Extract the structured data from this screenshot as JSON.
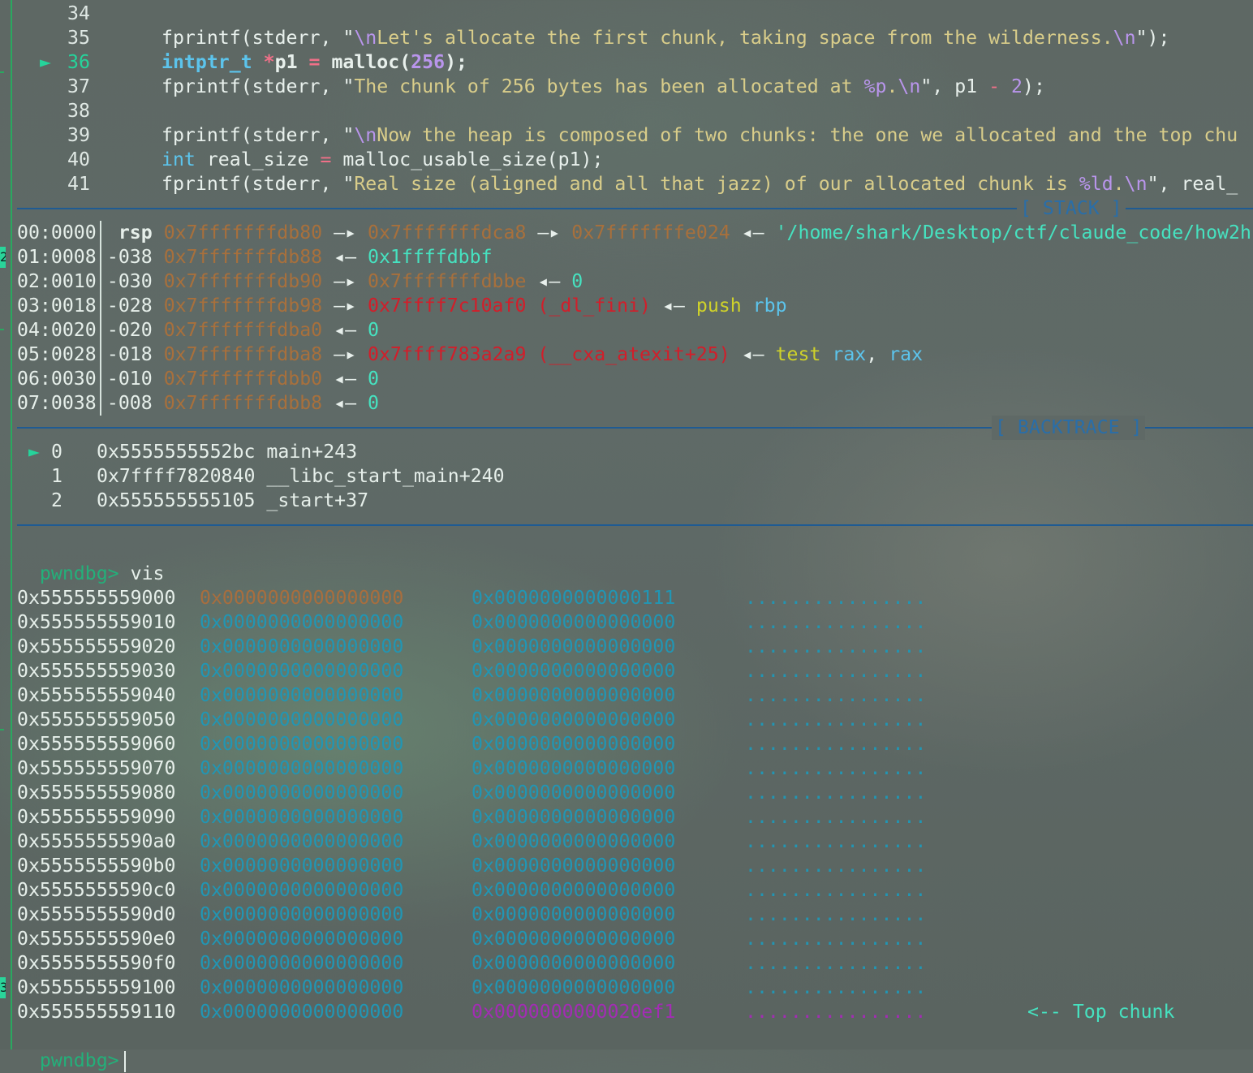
{
  "source": {
    "lines": [
      {
        "num": "34",
        "current": false,
        "tokens": []
      },
      {
        "num": "35",
        "current": false,
        "tokens": [
          {
            "t": "fprintf(stderr, \"",
            "c": "c-white"
          },
          {
            "t": "\\n",
            "c": "c-esc"
          },
          {
            "t": "Let's allocate the first chunk, taking space from the wilderness.",
            "c": "c-str"
          },
          {
            "t": "\\n",
            "c": "c-esc"
          },
          {
            "t": "\");",
            "c": "c-white"
          }
        ]
      },
      {
        "num": "36",
        "current": true,
        "arrow": "►",
        "tokens": [
          {
            "t": "intptr_t",
            "c": "c-type c-bold"
          },
          {
            "t": " ",
            "c": "c-white"
          },
          {
            "t": "*",
            "c": "c-op c-bold"
          },
          {
            "t": "p1",
            "c": "c-white c-bold"
          },
          {
            "t": " ",
            "c": "c-white"
          },
          {
            "t": "=",
            "c": "c-op c-bold"
          },
          {
            "t": " malloc(",
            "c": "c-white c-bold"
          },
          {
            "t": "256",
            "c": "c-num c-bold"
          },
          {
            "t": ");",
            "c": "c-white c-bold"
          }
        ]
      },
      {
        "num": "37",
        "current": false,
        "tokens": [
          {
            "t": "fprintf(stderr, \"",
            "c": "c-white"
          },
          {
            "t": "The chunk of 256 bytes has been allocated at ",
            "c": "c-str"
          },
          {
            "t": "%p",
            "c": "c-esc"
          },
          {
            "t": ".",
            "c": "c-str"
          },
          {
            "t": "\\n",
            "c": "c-esc"
          },
          {
            "t": "\", p1 ",
            "c": "c-white"
          },
          {
            "t": "-",
            "c": "c-op"
          },
          {
            "t": " ",
            "c": "c-white"
          },
          {
            "t": "2",
            "c": "c-num"
          },
          {
            "t": ");",
            "c": "c-white"
          }
        ]
      },
      {
        "num": "38",
        "current": false,
        "tokens": []
      },
      {
        "num": "39",
        "current": false,
        "tokens": [
          {
            "t": "fprintf(stderr, \"",
            "c": "c-white"
          },
          {
            "t": "\\n",
            "c": "c-esc"
          },
          {
            "t": "Now the heap is composed of two chunks: the one we allocated and the top chu",
            "c": "c-str"
          }
        ]
      },
      {
        "num": "40",
        "current": false,
        "tokens": [
          {
            "t": "int",
            "c": "c-type"
          },
          {
            "t": " real_size ",
            "c": "c-white"
          },
          {
            "t": "=",
            "c": "c-op"
          },
          {
            "t": " malloc_usable_size(p1);",
            "c": "c-white"
          }
        ]
      },
      {
        "num": "41",
        "current": false,
        "tokens": [
          {
            "t": "fprintf(stderr, \"",
            "c": "c-white"
          },
          {
            "t": "Real size (aligned and all that jazz) of our allocated chunk is ",
            "c": "c-str"
          },
          {
            "t": "%ld",
            "c": "c-esc"
          },
          {
            "t": ".",
            "c": "c-str"
          },
          {
            "t": "\\n",
            "c": "c-esc"
          },
          {
            "t": "\", real_",
            "c": "c-white"
          }
        ]
      }
    ]
  },
  "stack": {
    "title": "[ STACK ]",
    "rows": [
      {
        "idx": "00:0000",
        "off": "rsp",
        "tokens": [
          {
            "t": "0x7fffffffdb80",
            "c": "c-stk"
          },
          {
            "t": " —▸ ",
            "c": "c-arr"
          },
          {
            "t": "0x7fffffffdca8",
            "c": "c-stk"
          },
          {
            "t": " —▸ ",
            "c": "c-arr"
          },
          {
            "t": "0x7fffffffe024",
            "c": "c-stk"
          },
          {
            "t": " ◂— ",
            "c": "c-arr"
          },
          {
            "t": "'/home/shark/Desktop/ctf/claude_code/how2h",
            "c": "c-teal"
          }
        ]
      },
      {
        "idx": "01:0008",
        "off": "-038",
        "tokens": [
          {
            "t": "0x7fffffffdb88",
            "c": "c-stk"
          },
          {
            "t": " ◂— ",
            "c": "c-arr"
          },
          {
            "t": "0x1ffffdbbf",
            "c": "c-teal"
          }
        ]
      },
      {
        "idx": "02:0010",
        "off": "-030",
        "tokens": [
          {
            "t": "0x7fffffffdb90",
            "c": "c-stk"
          },
          {
            "t": " —▸ ",
            "c": "c-arr"
          },
          {
            "t": "0x7fffffffdbbe",
            "c": "c-stk"
          },
          {
            "t": " ◂— ",
            "c": "c-arr"
          },
          {
            "t": "0",
            "c": "c-teal"
          }
        ]
      },
      {
        "idx": "03:0018",
        "off": "-028",
        "tokens": [
          {
            "t": "0x7fffffffdb98",
            "c": "c-stk"
          },
          {
            "t": " —▸ ",
            "c": "c-arr"
          },
          {
            "t": "0x7ffff7c10af0 (_dl_fini)",
            "c": "c-red"
          },
          {
            "t": " ◂— ",
            "c": "c-arr"
          },
          {
            "t": "push",
            "c": "c-ins"
          },
          {
            "t": " ",
            "c": "c-arr"
          },
          {
            "t": "rbp",
            "c": "c-reg"
          }
        ]
      },
      {
        "idx": "04:0020",
        "off": "-020",
        "tokens": [
          {
            "t": "0x7fffffffdba0",
            "c": "c-stk"
          },
          {
            "t": " ◂— ",
            "c": "c-arr"
          },
          {
            "t": "0",
            "c": "c-teal"
          }
        ]
      },
      {
        "idx": "05:0028",
        "off": "-018",
        "tokens": [
          {
            "t": "0x7fffffffdba8",
            "c": "c-stk"
          },
          {
            "t": " —▸ ",
            "c": "c-arr"
          },
          {
            "t": "0x7ffff783a2a9 (__cxa_atexit+25)",
            "c": "c-red"
          },
          {
            "t": " ◂— ",
            "c": "c-arr"
          },
          {
            "t": "test",
            "c": "c-ins"
          },
          {
            "t": " ",
            "c": "c-arr"
          },
          {
            "t": "rax",
            "c": "c-reg"
          },
          {
            "t": ", ",
            "c": "c-arr"
          },
          {
            "t": "rax",
            "c": "c-reg"
          }
        ]
      },
      {
        "idx": "06:0030",
        "off": "-010",
        "tokens": [
          {
            "t": "0x7fffffffdbb0",
            "c": "c-stk"
          },
          {
            "t": " ◂— ",
            "c": "c-arr"
          },
          {
            "t": "0",
            "c": "c-teal"
          }
        ]
      },
      {
        "idx": "07:0038",
        "off": "-008",
        "tokens": [
          {
            "t": "0x7fffffffdbb8",
            "c": "c-stk"
          },
          {
            "t": " ◂— ",
            "c": "c-arr"
          },
          {
            "t": "0",
            "c": "c-teal"
          }
        ]
      }
    ]
  },
  "backtrace": {
    "title": "[ BACKTRACE ]",
    "frames": [
      {
        "marker": "►",
        "index": "0",
        "addr": "0x5555555552bc",
        "sym": "main+243"
      },
      {
        "marker": "",
        "index": "1",
        "addr": "0x7ffff7820840",
        "sym": "__libc_start_main+240"
      },
      {
        "marker": "",
        "index": "2",
        "addr": "0x555555555105",
        "sym": "_start+37"
      }
    ]
  },
  "prompt": {
    "label": "pwndbg>",
    "command": "vis"
  },
  "vis": {
    "rows": [
      {
        "addr": "0x555555559000",
        "q1": "0x0000000000000000",
        "q2": "0x0000000000000111",
        "ascii": "................",
        "q1c": "c-orange",
        "q2c": "c-cyan",
        "ac": "c-cyan"
      },
      {
        "addr": "0x555555559010",
        "q1": "0x0000000000000000",
        "q2": "0x0000000000000000",
        "ascii": "................",
        "q1c": "c-cyan",
        "q2c": "c-cyan",
        "ac": "c-cyan"
      },
      {
        "addr": "0x555555559020",
        "q1": "0x0000000000000000",
        "q2": "0x0000000000000000",
        "ascii": "................",
        "q1c": "c-cyan",
        "q2c": "c-cyan",
        "ac": "c-cyan"
      },
      {
        "addr": "0x555555559030",
        "q1": "0x0000000000000000",
        "q2": "0x0000000000000000",
        "ascii": "................",
        "q1c": "c-cyan",
        "q2c": "c-cyan",
        "ac": "c-cyan"
      },
      {
        "addr": "0x555555559040",
        "q1": "0x0000000000000000",
        "q2": "0x0000000000000000",
        "ascii": "................",
        "q1c": "c-cyan",
        "q2c": "c-cyan",
        "ac": "c-cyan"
      },
      {
        "addr": "0x555555559050",
        "q1": "0x0000000000000000",
        "q2": "0x0000000000000000",
        "ascii": "................",
        "q1c": "c-cyan",
        "q2c": "c-cyan",
        "ac": "c-cyan"
      },
      {
        "addr": "0x555555559060",
        "q1": "0x0000000000000000",
        "q2": "0x0000000000000000",
        "ascii": "................",
        "q1c": "c-cyan",
        "q2c": "c-cyan",
        "ac": "c-cyan"
      },
      {
        "addr": "0x555555559070",
        "q1": "0x0000000000000000",
        "q2": "0x0000000000000000",
        "ascii": "................",
        "q1c": "c-cyan",
        "q2c": "c-cyan",
        "ac": "c-cyan"
      },
      {
        "addr": "0x555555559080",
        "q1": "0x0000000000000000",
        "q2": "0x0000000000000000",
        "ascii": "................",
        "q1c": "c-cyan",
        "q2c": "c-cyan",
        "ac": "c-cyan"
      },
      {
        "addr": "0x555555559090",
        "q1": "0x0000000000000000",
        "q2": "0x0000000000000000",
        "ascii": "................",
        "q1c": "c-cyan",
        "q2c": "c-cyan",
        "ac": "c-cyan"
      },
      {
        "addr": "0x5555555590a0",
        "q1": "0x0000000000000000",
        "q2": "0x0000000000000000",
        "ascii": "................",
        "q1c": "c-cyan",
        "q2c": "c-cyan",
        "ac": "c-cyan"
      },
      {
        "addr": "0x5555555590b0",
        "q1": "0x0000000000000000",
        "q2": "0x0000000000000000",
        "ascii": "................",
        "q1c": "c-cyan",
        "q2c": "c-cyan",
        "ac": "c-cyan"
      },
      {
        "addr": "0x5555555590c0",
        "q1": "0x0000000000000000",
        "q2": "0x0000000000000000",
        "ascii": "................",
        "q1c": "c-cyan",
        "q2c": "c-cyan",
        "ac": "c-cyan"
      },
      {
        "addr": "0x5555555590d0",
        "q1": "0x0000000000000000",
        "q2": "0x0000000000000000",
        "ascii": "................",
        "q1c": "c-cyan",
        "q2c": "c-cyan",
        "ac": "c-cyan"
      },
      {
        "addr": "0x5555555590e0",
        "q1": "0x0000000000000000",
        "q2": "0x0000000000000000",
        "ascii": "................",
        "q1c": "c-cyan",
        "q2c": "c-cyan",
        "ac": "c-cyan"
      },
      {
        "addr": "0x5555555590f0",
        "q1": "0x0000000000000000",
        "q2": "0x0000000000000000",
        "ascii": "................",
        "q1c": "c-cyan",
        "q2c": "c-cyan",
        "ac": "c-cyan"
      },
      {
        "addr": "0x555555559100",
        "q1": "0x0000000000000000",
        "q2": "0x0000000000000000",
        "ascii": "................",
        "q1c": "c-cyan",
        "q2c": "c-cyan",
        "ac": "c-cyan"
      },
      {
        "addr": "0x555555559110",
        "q1": "0x0000000000000000",
        "q2": "0x0000000000020ef1",
        "ascii": "................",
        "q1c": "c-cyan",
        "q2c": "c-mag",
        "ac": "c-mag",
        "note": "<-- Top chunk"
      }
    ]
  },
  "final_prompt": {
    "label": "pwndbg>"
  },
  "gutter_marks": [
    {
      "text": "2"
    },
    {
      "text": "3"
    }
  ],
  "colors": {
    "prompt": "#23b07a",
    "separator": "#1f5b93",
    "string": "#d9cd8a",
    "stack_addr": "#a8703c",
    "symbol_red": "#d21e2a",
    "top_chunk": "#a32cb4"
  }
}
